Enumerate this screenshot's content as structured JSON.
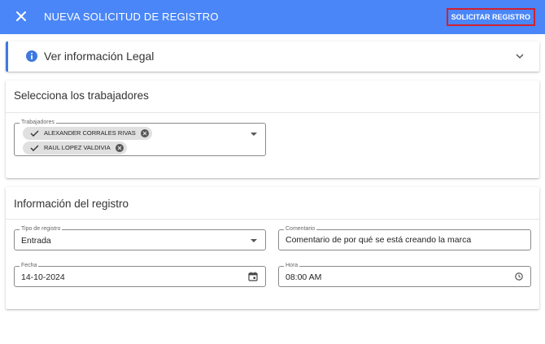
{
  "app": {
    "title": "NUEVA SOLICITUD DE REGISTRO",
    "action_label": "SOLICITAR REGISTRO",
    "primary_color": "#4a86f7",
    "action_outline_color": "#d2202f"
  },
  "legal": {
    "label": "Ver información Legal",
    "icon": "info-icon",
    "expand_icon": "chevron-down-icon"
  },
  "workers": {
    "section_title": "Selecciona los trabajadores",
    "field_label": "Trabajadores",
    "selected": [
      {
        "name": "ALEXANDER CORRALES RIVAS"
      },
      {
        "name": "RAUL LOPEZ VALDIVIA"
      }
    ]
  },
  "registro": {
    "section_title": "Información del registro",
    "tipo": {
      "label": "Tipo de registro",
      "value": "Entrada"
    },
    "comentario": {
      "label": "Comentario",
      "value": "Comentario de por qué se está creando la marca"
    },
    "fecha": {
      "label": "Fecha",
      "value": "14-10-2024",
      "icon": "calendar-icon"
    },
    "hora": {
      "label": "Hora",
      "value": "08:00 AM",
      "icon": "clock-icon"
    }
  }
}
